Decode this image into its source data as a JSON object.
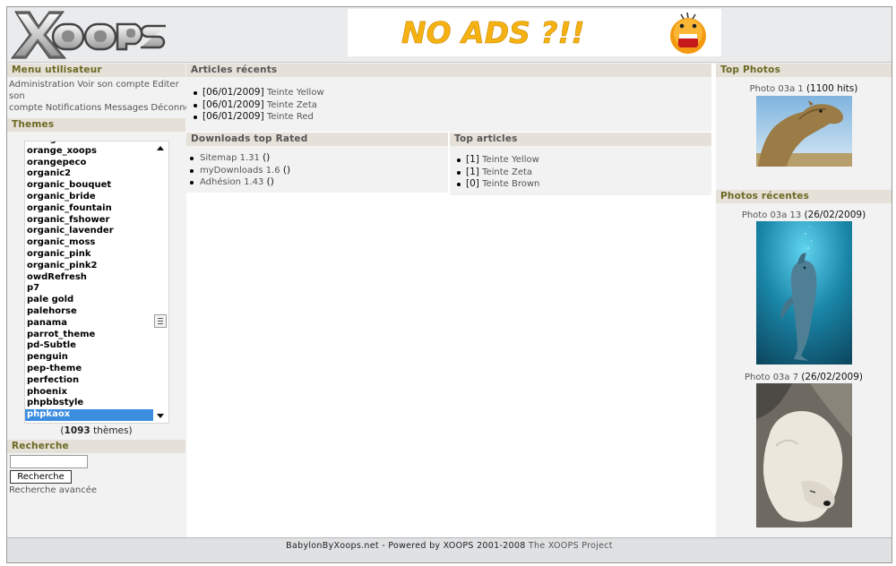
{
  "header": {
    "logo_text": "XOOPS",
    "banner_text": "NO ADS ?!!"
  },
  "user_menu": {
    "title": "Menu utilisateur",
    "links": [
      "Administration",
      "Voir son compte",
      "Editer son compte",
      "Notifications",
      "Messages",
      "Déconnexion"
    ]
  },
  "themes": {
    "title": "Themes",
    "options": [
      "orange-shine",
      "orange_xoops",
      "orangepeco",
      "organic2",
      "organic_bouquet",
      "organic_bride",
      "organic_fountain",
      "organic_fshower",
      "organic_lavender",
      "organic_moss",
      "organic_pink",
      "organic_pink2",
      "owdRefresh",
      "p7",
      "pale gold",
      "palehorse",
      "panama",
      "parrot_theme",
      "pd-Subtle",
      "penguin",
      "pep-theme",
      "perfection",
      "phoenix",
      "phpbbstyle",
      "phpkaox"
    ],
    "selected": "phpkaox",
    "count": "1093",
    "count_suffix": " thèmes)",
    "count_prefix": "("
  },
  "search": {
    "title": "Recherche",
    "button": "Recherche",
    "advanced": "Recherche avancée",
    "value": ""
  },
  "recent_articles": {
    "title": "Articles récents",
    "items": [
      {
        "date": "[06/01/2009]",
        "label": "Teinte Yellow"
      },
      {
        "date": "[06/01/2009]",
        "label": "Teinte Zeta"
      },
      {
        "date": "[06/01/2009]",
        "label": "Teinte Red"
      }
    ]
  },
  "downloads": {
    "title": "Downloads top Rated",
    "items": [
      {
        "label": "Sitemap 1.31",
        "suffix": "()"
      },
      {
        "label": "myDownloads 1.6",
        "suffix": "()"
      },
      {
        "label": "Adhésion 1.43",
        "suffix": "()"
      }
    ]
  },
  "top_articles": {
    "title": "Top articles",
    "items": [
      {
        "rank": "[1]",
        "label": "Teinte Yellow"
      },
      {
        "rank": "[1]",
        "label": "Teinte Zeta"
      },
      {
        "rank": "[0]",
        "label": "Teinte Brown"
      }
    ]
  },
  "top_photos": {
    "title": "Top Photos",
    "caption": "Photo 03a 1",
    "hits": "(1100 hits)",
    "photo_subject": "camel"
  },
  "recent_photos": {
    "title": "Photos récentes",
    "items": [
      {
        "caption": "Photo 03a 13",
        "date": "(26/02/2009)",
        "subject": "dolphin"
      },
      {
        "caption": "Photo 03a 7",
        "date": "(26/02/2009)",
        "subject": "polar-bear"
      }
    ]
  },
  "footer": {
    "text": "BabylonByXoops.net - Powered by XOOPS 2001-2008",
    "link": "The XOOPS Project"
  },
  "colors": {
    "block_title_bg": "#e5e0d8",
    "title_olive": "#6b6a22",
    "selection_blue": "#3b8de0"
  }
}
